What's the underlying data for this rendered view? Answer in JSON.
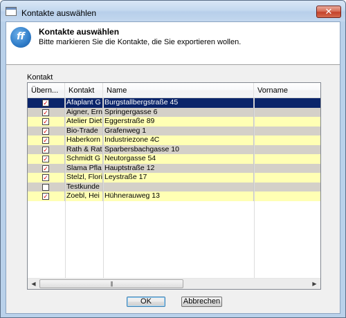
{
  "window": {
    "title": "Kontakte auswählen",
    "close_glyph": "✕"
  },
  "header": {
    "logo_text": "ff",
    "title": "Kontakte auswählen",
    "subtitle": "Bitte markieren Sie die Kontakte, die Sie exportieren wollen."
  },
  "group_label": "Kontakt",
  "grid": {
    "columns": [
      "Übern...",
      "Kontakt",
      "Name",
      "Vorname"
    ],
    "rows": [
      {
        "checked": true,
        "kontakt": "Afaplant G",
        "name": "Burgstallbergstraße 45",
        "vorname": "",
        "color": "#0a246a",
        "selected": true
      },
      {
        "checked": true,
        "kontakt": "Aigner, Ern",
        "name": "Springergasse 6",
        "vorname": "",
        "color": "#d4d0c8"
      },
      {
        "checked": true,
        "kontakt": "Atelier Diet",
        "name": "Eggerstraße 89",
        "vorname": "",
        "color": "#ffffb4"
      },
      {
        "checked": true,
        "kontakt": "Bio-Trade",
        "name": "Grafenweg 1",
        "vorname": "",
        "color": "#d4d0c8"
      },
      {
        "checked": true,
        "kontakt": "Haberkorn",
        "name": "Industriezone 4C",
        "vorname": "",
        "color": "#ffffb4"
      },
      {
        "checked": true,
        "kontakt": "Rath & Rat",
        "name": "Sparbersbachgasse 10",
        "vorname": "",
        "color": "#d4d0c8"
      },
      {
        "checked": true,
        "kontakt": "Schmidt G",
        "name": "Neutorgasse 54",
        "vorname": "",
        "color": "#ffffb4"
      },
      {
        "checked": true,
        "kontakt": "Slama Pfla",
        "name": "Hauptstraße 12",
        "vorname": "",
        "color": "#d4d0c8"
      },
      {
        "checked": true,
        "kontakt": "Stelzl, Flori",
        "name": "Leystraße 17",
        "vorname": "",
        "color": "#ffffb4"
      },
      {
        "checked": false,
        "kontakt": "Testkunde",
        "name": "",
        "vorname": "",
        "color": "#d4d0c8"
      },
      {
        "checked": true,
        "kontakt": "Zoebl, Hei",
        "name": "Hühnerauweg 13",
        "vorname": "",
        "color": "#ffffb4"
      }
    ]
  },
  "scrollbar": {
    "left_glyph": "◀",
    "right_glyph": "▶",
    "grip_glyph": "|||"
  },
  "buttons": {
    "ok": "OK",
    "cancel": "Abbrechen"
  },
  "colors": {
    "selection": "#0a246a",
    "alt_row_gray": "#d4d0c8",
    "alt_row_yellow": "#ffffb4",
    "check_red": "#d40000"
  }
}
